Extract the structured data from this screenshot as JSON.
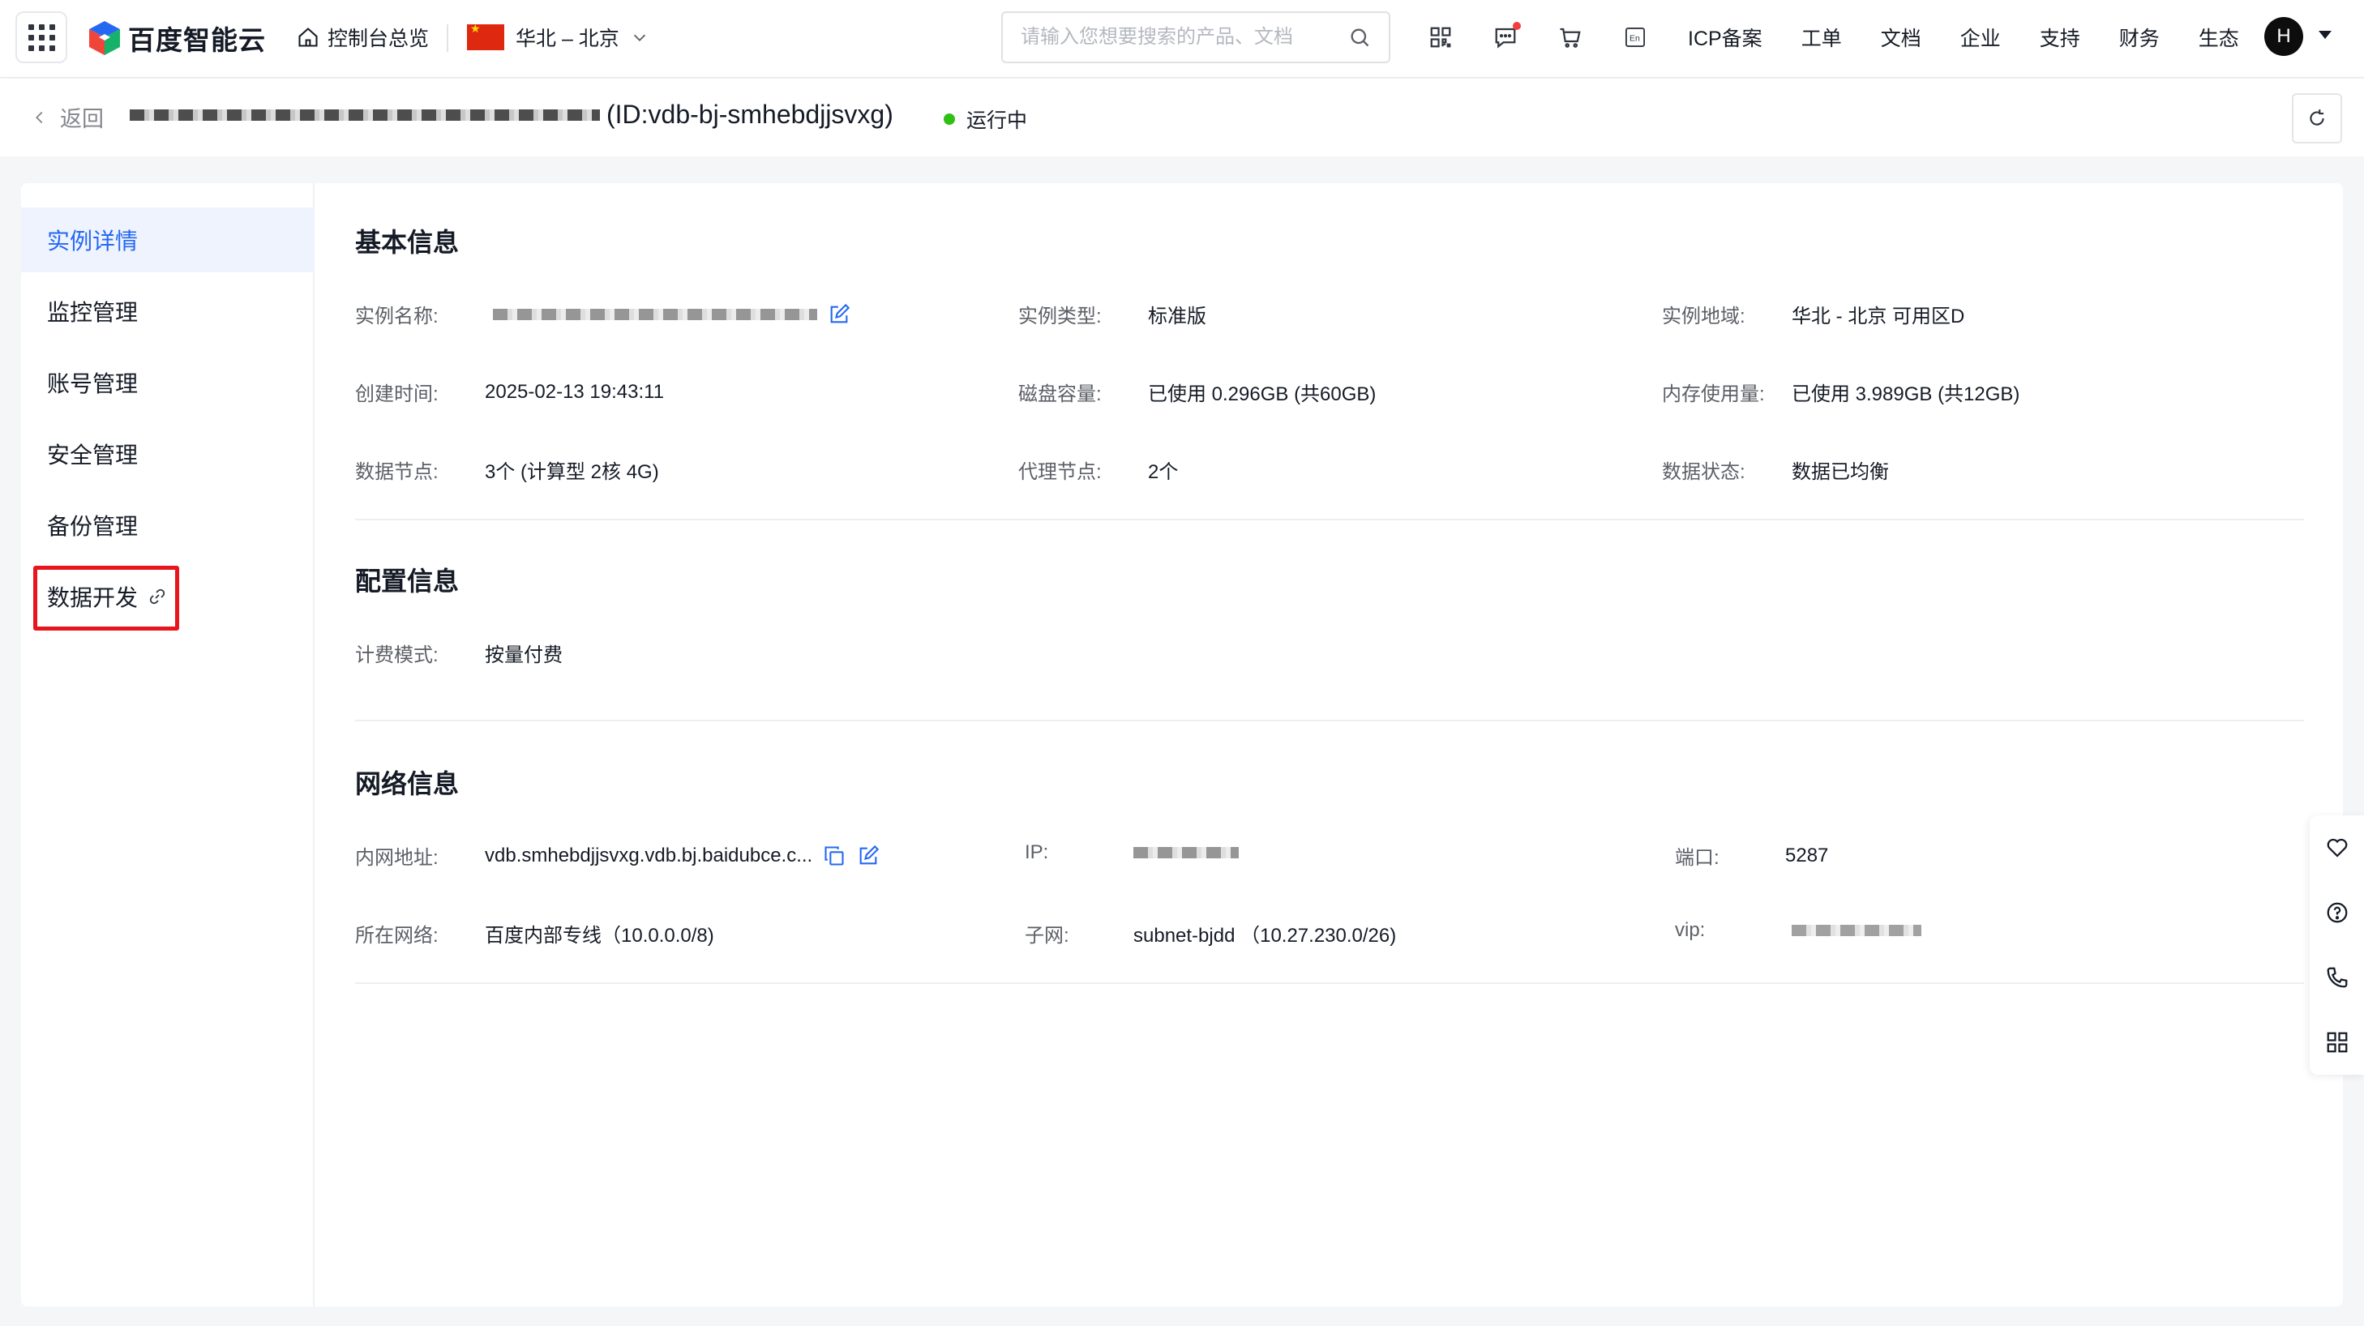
{
  "topnav": {
    "brand": "百度智能云",
    "home_label": "控制台总览",
    "region_label": "华北 – 北京",
    "search_placeholder": "请输入您想要搜索的产品、文档",
    "links": [
      "ICP备案",
      "工单",
      "文档",
      "企业",
      "支持",
      "财务",
      "生态"
    ],
    "avatar_initial": "H",
    "icons": [
      "qrcode-icon",
      "message-icon",
      "cart-icon",
      "language-en-icon"
    ]
  },
  "header": {
    "back_label": "返回",
    "instance_id": "(ID:vdb-bj-smhebdjjsvxg)",
    "status_label": "运行中",
    "status_color": "#30bf13"
  },
  "sidebar": {
    "items": [
      {
        "label": "实例详情",
        "active": true
      },
      {
        "label": "监控管理"
      },
      {
        "label": "账号管理"
      },
      {
        "label": "安全管理"
      },
      {
        "label": "备份管理"
      },
      {
        "label": "数据开发",
        "external_link": true
      }
    ]
  },
  "basic": {
    "title": "基本信息",
    "name_label": "实例名称:",
    "type_label": "实例类型:",
    "type_value": "标准版",
    "zone_label": "实例地域:",
    "zone_value": "华北 - 北京 可用区D",
    "created_label": "创建时间:",
    "created_value": "2025-02-13 19:43:11",
    "disk_label": "磁盘容量:",
    "disk_value": "已使用 0.296GB (共60GB)",
    "mem_label": "内存使用量:",
    "mem_value": "已使用 3.989GB (共12GB)",
    "nodes_label": "数据节点:",
    "nodes_value": "3个 (计算型 2核 4G)",
    "proxy_label": "代理节点:",
    "proxy_value": "2个",
    "state_label": "数据状态:",
    "state_value": "数据已均衡"
  },
  "config": {
    "title": "配置信息",
    "billing_label": "计费模式:",
    "billing_value": "按量付费"
  },
  "network": {
    "title": "网络信息",
    "intranet_label": "内网地址:",
    "intranet_value": "vdb.smhebdjjsvxg.vdb.bj.baidubce.c...",
    "ip_label": "IP:",
    "port_label": "端口:",
    "port_value": "5287",
    "vpc_label": "所在网络:",
    "vpc_value": "百度内部专线（10.0.0.0/8)",
    "subnet_label": "子网:",
    "subnet_value": "subnet-bjdd （10.27.230.0/26)",
    "vip_label": "vip:"
  },
  "colors": {
    "accent": "#2468f2",
    "highlight_box": "#e8161c"
  }
}
